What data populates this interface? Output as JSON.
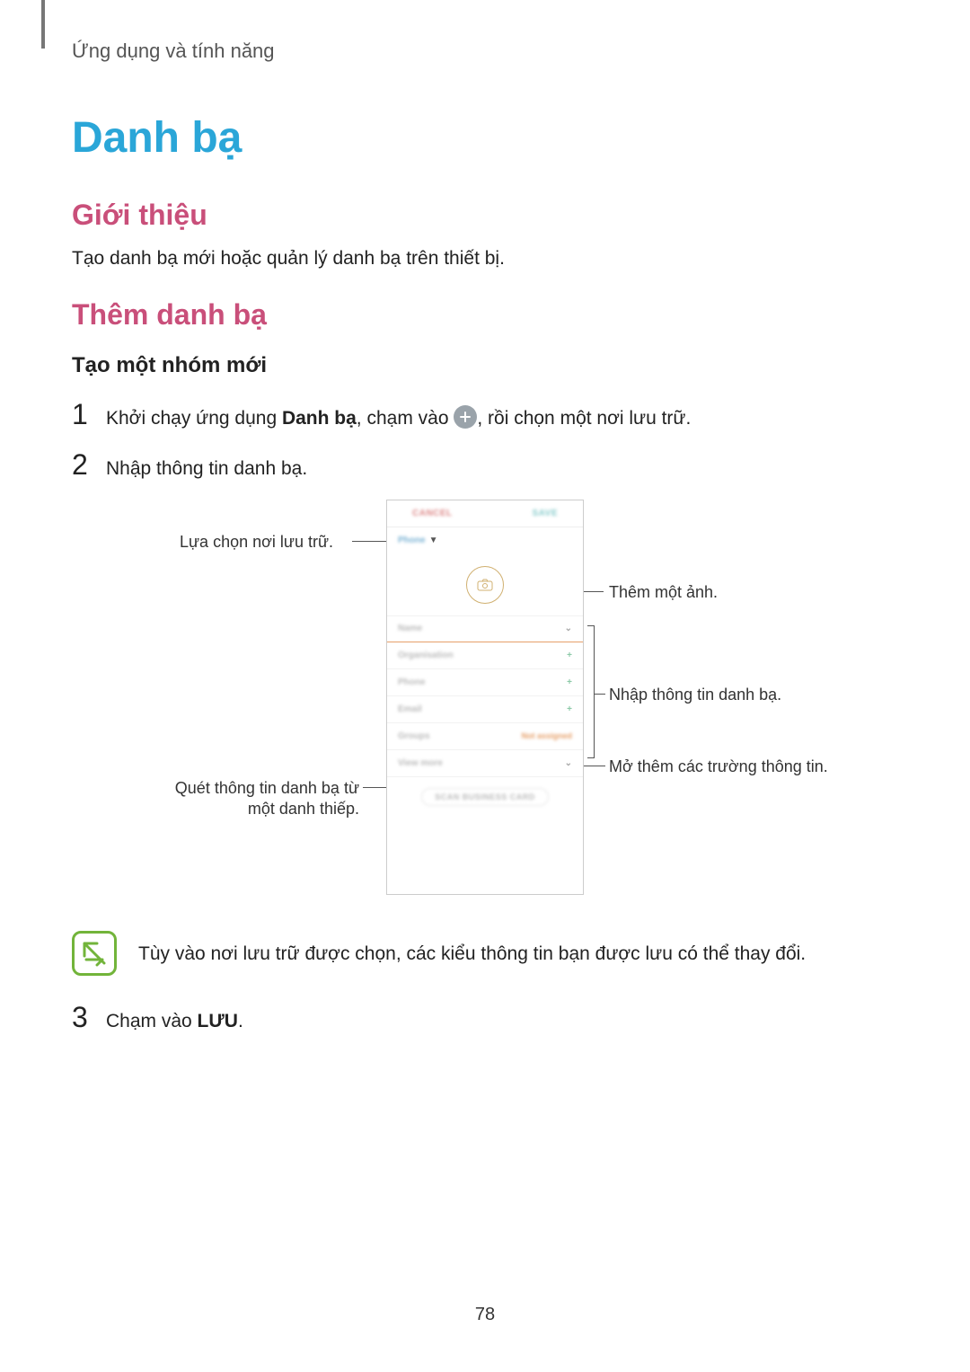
{
  "breadcrumb": "Ứng dụng và tính năng",
  "title_h1": "Danh bạ",
  "section_intro": {
    "heading": "Giới thiệu",
    "body": "Tạo danh bạ mới hoặc quản lý danh bạ trên thiết bị."
  },
  "section_add": {
    "heading": "Thêm danh bạ",
    "sub_heading": "Tạo một nhóm mới"
  },
  "steps": {
    "s1_pre": "Khởi chạy ứng dụng ",
    "s1_app": "Danh bạ",
    "s1_mid": ", chạm vào ",
    "s1_post": ", rồi chọn một nơi lưu trữ.",
    "s2": "Nhập thông tin danh bạ.",
    "s3_pre": "Chạm vào ",
    "s3_btn": "LƯU",
    "s3_post": "."
  },
  "callouts": {
    "left_storage": "Lựa chọn nơi lưu trữ.",
    "left_scan": "Quét thông tin danh bạ từ một danh thiếp.",
    "right_photo": "Thêm một ảnh.",
    "right_input": "Nhập thông tin danh bạ.",
    "right_more": "Mở thêm các trường thông tin."
  },
  "note_text": "Tùy vào nơi lưu trữ được chọn, các kiểu thông tin bạn được lưu có thể thay đổi.",
  "page_number": "78",
  "mock": {
    "cancel": "CANCEL",
    "save": "SAVE",
    "storage": "Phone",
    "f_name": "Name",
    "f_org": "Organisation",
    "f_phone": "Phone",
    "f_email": "Email",
    "f_groups": "Groups",
    "f_groups_val": "Not assigned",
    "f_more": "View more",
    "scan": "SCAN BUSINESS CARD"
  }
}
